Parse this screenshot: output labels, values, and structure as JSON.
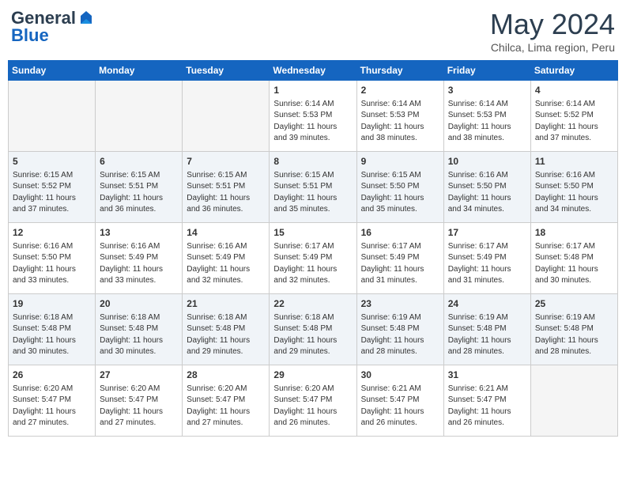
{
  "header": {
    "logo_general": "General",
    "logo_blue": "Blue",
    "month_title": "May 2024",
    "location": "Chilca, Lima region, Peru"
  },
  "days_of_week": [
    "Sunday",
    "Monday",
    "Tuesday",
    "Wednesday",
    "Thursday",
    "Friday",
    "Saturday"
  ],
  "weeks": [
    [
      {
        "day": "",
        "sunrise": "",
        "sunset": "",
        "daylight": "",
        "empty": true
      },
      {
        "day": "",
        "sunrise": "",
        "sunset": "",
        "daylight": "",
        "empty": true
      },
      {
        "day": "",
        "sunrise": "",
        "sunset": "",
        "daylight": "",
        "empty": true
      },
      {
        "day": "1",
        "sunrise": "Sunrise: 6:14 AM",
        "sunset": "Sunset: 5:53 PM",
        "daylight": "Daylight: 11 hours and 39 minutes.",
        "empty": false
      },
      {
        "day": "2",
        "sunrise": "Sunrise: 6:14 AM",
        "sunset": "Sunset: 5:53 PM",
        "daylight": "Daylight: 11 hours and 38 minutes.",
        "empty": false
      },
      {
        "day": "3",
        "sunrise": "Sunrise: 6:14 AM",
        "sunset": "Sunset: 5:53 PM",
        "daylight": "Daylight: 11 hours and 38 minutes.",
        "empty": false
      },
      {
        "day": "4",
        "sunrise": "Sunrise: 6:14 AM",
        "sunset": "Sunset: 5:52 PM",
        "daylight": "Daylight: 11 hours and 37 minutes.",
        "empty": false
      }
    ],
    [
      {
        "day": "5",
        "sunrise": "Sunrise: 6:15 AM",
        "sunset": "Sunset: 5:52 PM",
        "daylight": "Daylight: 11 hours and 37 minutes.",
        "empty": false
      },
      {
        "day": "6",
        "sunrise": "Sunrise: 6:15 AM",
        "sunset": "Sunset: 5:51 PM",
        "daylight": "Daylight: 11 hours and 36 minutes.",
        "empty": false
      },
      {
        "day": "7",
        "sunrise": "Sunrise: 6:15 AM",
        "sunset": "Sunset: 5:51 PM",
        "daylight": "Daylight: 11 hours and 36 minutes.",
        "empty": false
      },
      {
        "day": "8",
        "sunrise": "Sunrise: 6:15 AM",
        "sunset": "Sunset: 5:51 PM",
        "daylight": "Daylight: 11 hours and 35 minutes.",
        "empty": false
      },
      {
        "day": "9",
        "sunrise": "Sunrise: 6:15 AM",
        "sunset": "Sunset: 5:50 PM",
        "daylight": "Daylight: 11 hours and 35 minutes.",
        "empty": false
      },
      {
        "day": "10",
        "sunrise": "Sunrise: 6:16 AM",
        "sunset": "Sunset: 5:50 PM",
        "daylight": "Daylight: 11 hours and 34 minutes.",
        "empty": false
      },
      {
        "day": "11",
        "sunrise": "Sunrise: 6:16 AM",
        "sunset": "Sunset: 5:50 PM",
        "daylight": "Daylight: 11 hours and 34 minutes.",
        "empty": false
      }
    ],
    [
      {
        "day": "12",
        "sunrise": "Sunrise: 6:16 AM",
        "sunset": "Sunset: 5:50 PM",
        "daylight": "Daylight: 11 hours and 33 minutes.",
        "empty": false
      },
      {
        "day": "13",
        "sunrise": "Sunrise: 6:16 AM",
        "sunset": "Sunset: 5:49 PM",
        "daylight": "Daylight: 11 hours and 33 minutes.",
        "empty": false
      },
      {
        "day": "14",
        "sunrise": "Sunrise: 6:16 AM",
        "sunset": "Sunset: 5:49 PM",
        "daylight": "Daylight: 11 hours and 32 minutes.",
        "empty": false
      },
      {
        "day": "15",
        "sunrise": "Sunrise: 6:17 AM",
        "sunset": "Sunset: 5:49 PM",
        "daylight": "Daylight: 11 hours and 32 minutes.",
        "empty": false
      },
      {
        "day": "16",
        "sunrise": "Sunrise: 6:17 AM",
        "sunset": "Sunset: 5:49 PM",
        "daylight": "Daylight: 11 hours and 31 minutes.",
        "empty": false
      },
      {
        "day": "17",
        "sunrise": "Sunrise: 6:17 AM",
        "sunset": "Sunset: 5:49 PM",
        "daylight": "Daylight: 11 hours and 31 minutes.",
        "empty": false
      },
      {
        "day": "18",
        "sunrise": "Sunrise: 6:17 AM",
        "sunset": "Sunset: 5:48 PM",
        "daylight": "Daylight: 11 hours and 30 minutes.",
        "empty": false
      }
    ],
    [
      {
        "day": "19",
        "sunrise": "Sunrise: 6:18 AM",
        "sunset": "Sunset: 5:48 PM",
        "daylight": "Daylight: 11 hours and 30 minutes.",
        "empty": false
      },
      {
        "day": "20",
        "sunrise": "Sunrise: 6:18 AM",
        "sunset": "Sunset: 5:48 PM",
        "daylight": "Daylight: 11 hours and 30 minutes.",
        "empty": false
      },
      {
        "day": "21",
        "sunrise": "Sunrise: 6:18 AM",
        "sunset": "Sunset: 5:48 PM",
        "daylight": "Daylight: 11 hours and 29 minutes.",
        "empty": false
      },
      {
        "day": "22",
        "sunrise": "Sunrise: 6:18 AM",
        "sunset": "Sunset: 5:48 PM",
        "daylight": "Daylight: 11 hours and 29 minutes.",
        "empty": false
      },
      {
        "day": "23",
        "sunrise": "Sunrise: 6:19 AM",
        "sunset": "Sunset: 5:48 PM",
        "daylight": "Daylight: 11 hours and 28 minutes.",
        "empty": false
      },
      {
        "day": "24",
        "sunrise": "Sunrise: 6:19 AM",
        "sunset": "Sunset: 5:48 PM",
        "daylight": "Daylight: 11 hours and 28 minutes.",
        "empty": false
      },
      {
        "day": "25",
        "sunrise": "Sunrise: 6:19 AM",
        "sunset": "Sunset: 5:48 PM",
        "daylight": "Daylight: 11 hours and 28 minutes.",
        "empty": false
      }
    ],
    [
      {
        "day": "26",
        "sunrise": "Sunrise: 6:20 AM",
        "sunset": "Sunset: 5:47 PM",
        "daylight": "Daylight: 11 hours and 27 minutes.",
        "empty": false
      },
      {
        "day": "27",
        "sunrise": "Sunrise: 6:20 AM",
        "sunset": "Sunset: 5:47 PM",
        "daylight": "Daylight: 11 hours and 27 minutes.",
        "empty": false
      },
      {
        "day": "28",
        "sunrise": "Sunrise: 6:20 AM",
        "sunset": "Sunset: 5:47 PM",
        "daylight": "Daylight: 11 hours and 27 minutes.",
        "empty": false
      },
      {
        "day": "29",
        "sunrise": "Sunrise: 6:20 AM",
        "sunset": "Sunset: 5:47 PM",
        "daylight": "Daylight: 11 hours and 26 minutes.",
        "empty": false
      },
      {
        "day": "30",
        "sunrise": "Sunrise: 6:21 AM",
        "sunset": "Sunset: 5:47 PM",
        "daylight": "Daylight: 11 hours and 26 minutes.",
        "empty": false
      },
      {
        "day": "31",
        "sunrise": "Sunrise: 6:21 AM",
        "sunset": "Sunset: 5:47 PM",
        "daylight": "Daylight: 11 hours and 26 minutes.",
        "empty": false
      },
      {
        "day": "",
        "sunrise": "",
        "sunset": "",
        "daylight": "",
        "empty": true
      }
    ]
  ]
}
